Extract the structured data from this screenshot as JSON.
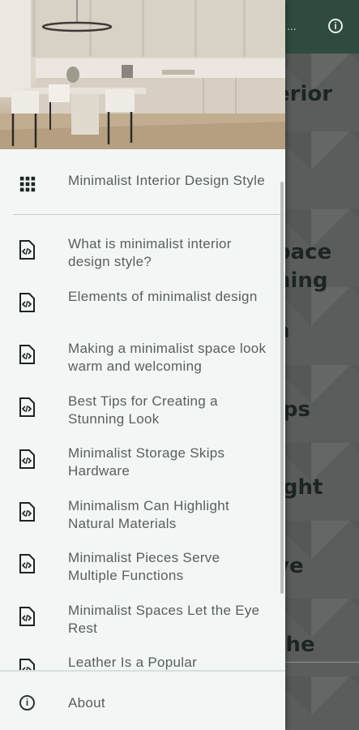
{
  "background": {
    "toolbar_overflow_text": "...",
    "titles": [
      "erior",
      "t",
      "pace",
      "ning",
      "a",
      "ips",
      "ight",
      "ve",
      "the"
    ]
  },
  "drawer": {
    "header_image": "kitchen-dining-interior-photo",
    "home_item": {
      "icon": "grid-apps-icon",
      "label": "Minimalist Interior Design Style"
    },
    "items": [
      {
        "icon": "code-file-icon",
        "label": "What is minimalist interior design style?"
      },
      {
        "icon": "code-file-icon",
        "label": "Elements of minimalist design"
      },
      {
        "icon": "code-file-icon",
        "label": "Making a minimalist space look warm and welcoming"
      },
      {
        "icon": "code-file-icon",
        "label": "Best Tips for Creating a Stunning Look"
      },
      {
        "icon": "code-file-icon",
        "label": "Minimalist Storage Skips Hardware"
      },
      {
        "icon": "code-file-icon",
        "label": "Minimalism Can Highlight Natural Materials"
      },
      {
        "icon": "code-file-icon",
        "label": "Minimalist Pieces Serve Multiple Functions"
      },
      {
        "icon": "code-file-icon",
        "label": "Minimalist Spaces Let the Eye Rest"
      },
      {
        "icon": "code-file-icon",
        "label": "Leather Is a Popular"
      }
    ],
    "about_label": "About"
  },
  "colors": {
    "toolbar": "#2f4b3f",
    "drawer_bg": "#f2f7f6",
    "text": "#5a5e5d"
  }
}
